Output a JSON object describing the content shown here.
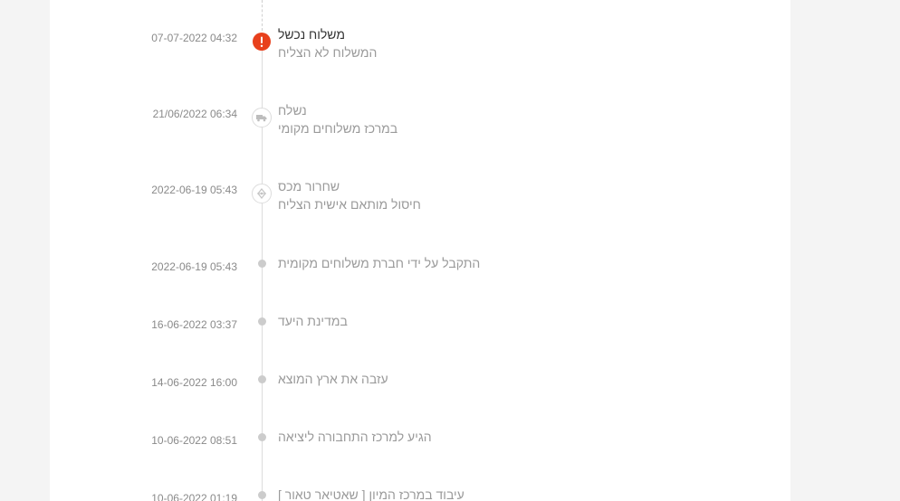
{
  "events": [
    {
      "date": "07-07-2022 04:32",
      "title": "משלוח נכשל",
      "subtitle": "המשלוח לא הצליח",
      "icon": "alert-icon",
      "status": "failed"
    },
    {
      "date": "21/06/2022 06:34",
      "title": "נשלח",
      "subtitle": "במרכז משלוחים מקומי",
      "icon": "truck-icon",
      "status": "shipped"
    },
    {
      "date": "2022-06-19 05:43",
      "title": "שחרור מכס",
      "subtitle": "חיסול מותאם אישית הצליח",
      "icon": "customs-icon",
      "status": "customs"
    },
    {
      "date": "2022-06-19 05:43",
      "title": "התקבל על ידי חברת משלוחים מקומית",
      "icon": "dot-icon"
    },
    {
      "date": "16-06-2022 03:37",
      "title": "במדינת היעד",
      "icon": "dot-icon"
    },
    {
      "date": "14-06-2022 16:00",
      "title": "עזבה את ארץ המוצא",
      "icon": "dot-icon"
    },
    {
      "date": "10-06-2022 08:51",
      "title": "הגיע למרכז התחבורה ליציאה",
      "icon": "dot-icon"
    },
    {
      "date": "10-06-2022 01:19",
      "title": "עיבוד במרכז המיון [ שאטיאר טאור ]",
      "icon": "dot-icon"
    }
  ],
  "colors": {
    "alert": "#e8401c",
    "timeline_line": "#dcdcdc",
    "muted_text": "#9a9a9a",
    "emphasis_text": "#333333",
    "page_background": "#f4f4f4",
    "panel_background": "#ffffff"
  }
}
